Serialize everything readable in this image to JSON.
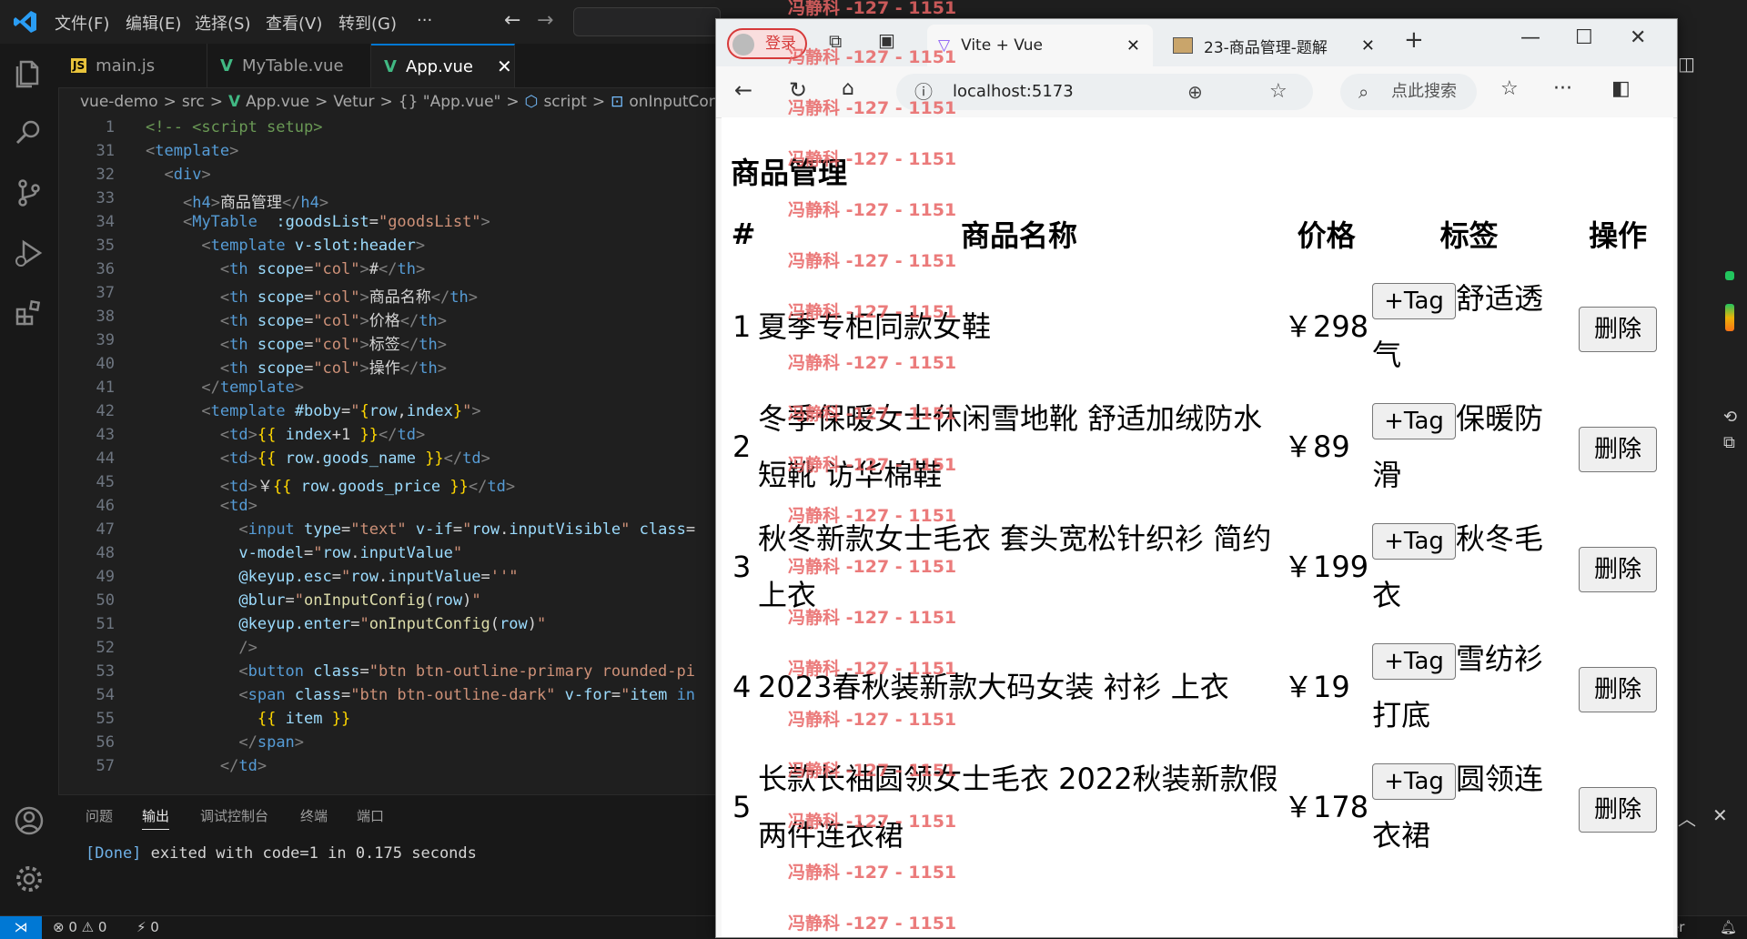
{
  "vscode": {
    "menu": [
      "文件(F)",
      "编辑(E)",
      "选择(S)",
      "查看(V)",
      "转到(G)",
      "···"
    ],
    "tabs": [
      {
        "label": "main.js",
        "icon": "JS"
      },
      {
        "label": "MyTable.vue",
        "icon": "V"
      },
      {
        "label": "App.vue",
        "icon": "V"
      }
    ],
    "breadcrumb": [
      "vue-demo",
      ">",
      "src",
      ">",
      "App.vue",
      ">",
      "Vetur",
      ">",
      "{} \"App.vue\"",
      ">",
      "script",
      ">",
      "onInputConfig"
    ],
    "panel_tabs": [
      "问题",
      "输出",
      "调试控制台",
      "终端",
      "端口"
    ],
    "output_done": "[Done]",
    "output_rest": " exited with code=1 in 0.175 seconds",
    "status": {
      "errors": "⊗ 0 ⚠ 0",
      "ports": "⚡ 0",
      "right_text": "er"
    }
  },
  "browser": {
    "login_label": "登录",
    "tabs": [
      {
        "title": "Vite + Vue",
        "favicon": "vite-icon"
      },
      {
        "title": "23-商品管理-题解",
        "favicon": "image-icon"
      }
    ],
    "url": "localhost:5173",
    "search_placeholder": "点此搜索"
  },
  "page": {
    "title": "商品管理",
    "headers": [
      "#",
      "商品名称",
      "价格",
      "标签",
      "操作"
    ],
    "tag_button": "+Tag",
    "delete_button": "删除",
    "rows": [
      {
        "index": "1",
        "name": "夏季专柜同款女鞋",
        "price": "￥298",
        "tag": "舒适透气"
      },
      {
        "index": "2",
        "name": "冬季保暖女士休闲雪地靴 舒适加绒防水短靴 访华棉鞋",
        "price": "￥89",
        "tag": "保暖防滑"
      },
      {
        "index": "3",
        "name": "秋冬新款女士毛衣 套头宽松针织衫 简约上衣",
        "price": "￥199",
        "tag": "秋冬毛衣"
      },
      {
        "index": "4",
        "name": "2023春秋装新款大码女装 衬衫 上衣",
        "price": "￥19",
        "tag": "雪纺衫打底"
      },
      {
        "index": "5",
        "name": "长款长袖圆领女士毛衣 2022秋装新款假两件连衣裙",
        "price": "￥178",
        "tag": "圆领连衣裙"
      }
    ]
  },
  "watermark": "冯静科 -127 - 1151"
}
